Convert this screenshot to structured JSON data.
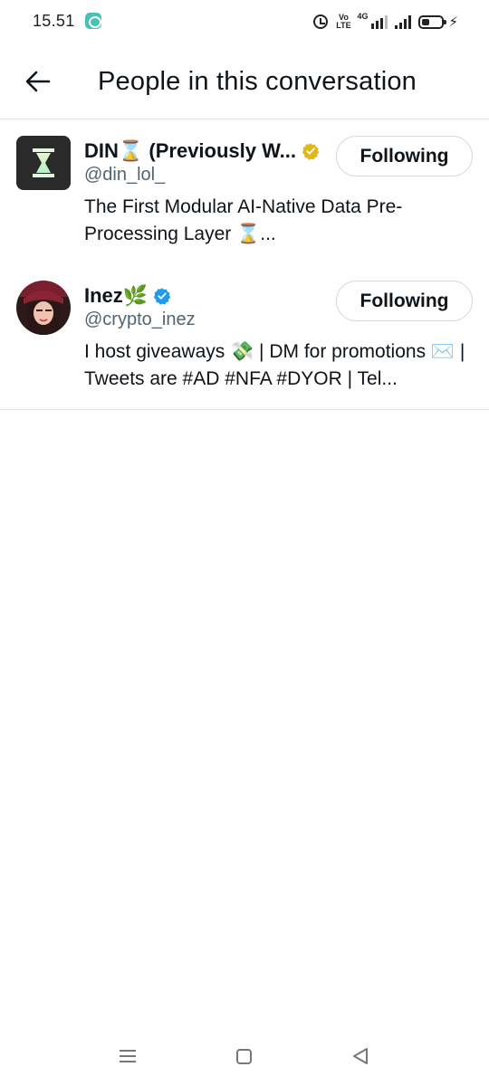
{
  "status_bar": {
    "time": "15.51",
    "volte_label": "Vo LTE",
    "network_label": "4G",
    "icons": [
      "app-notification-icon",
      "alarm-icon",
      "volte-icon",
      "signal-icon",
      "battery-icon",
      "charging-icon"
    ]
  },
  "header": {
    "title": "People in this conversation",
    "back_icon": "arrow-left-icon"
  },
  "users": [
    {
      "name": "DIN⌛ (Previously W...",
      "handle": "@din_lol_",
      "bio": "The First Modular AI-Native Data Pre-Processing Layer ⌛...",
      "badge": "gold-verified",
      "badge_color": "#e2b719",
      "follow_label": "Following"
    },
    {
      "name": "Inez🌿",
      "handle": "@crypto_inez",
      "bio": "I host giveaways 💸 | DM for promotions ✉️ | Tweets are #AD #NFA #DYOR | Tel...",
      "badge": "blue-verified",
      "badge_color": "#1d9bf0",
      "follow_label": "Following"
    }
  ],
  "nav_bar": {
    "icons": [
      "recent-apps-icon",
      "home-icon",
      "back-icon"
    ]
  }
}
